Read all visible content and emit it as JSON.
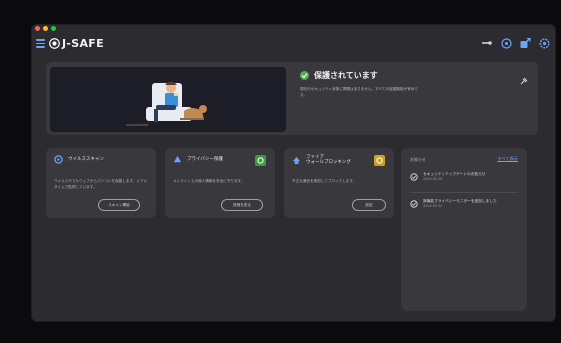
{
  "window": {
    "traffic_colors": [
      "#ff5f57",
      "#febc2e",
      "#28c840"
    ]
  },
  "titlebar": {
    "app_name": "J-SAFE",
    "icons": [
      "hamburger-icon",
      "globe-logo-icon",
      "key-icon",
      "help-icon",
      "share-icon",
      "settings-icon"
    ]
  },
  "hero": {
    "status_title": "保護されています",
    "status_desc": "現在のセキュリティ状態に問題はありません。すべての保護機能が有効です。",
    "accent": "#4caf50"
  },
  "cards": [
    {
      "id": "scan",
      "label": "ウイルススキャン",
      "icon": "shield-scan-icon",
      "desc": "ウイルスやマルウェアからパソコンを保護します。リアルタイムで監視しています。",
      "button": "スキャン開始",
      "badge": null
    },
    {
      "id": "privacy",
      "label": "プライバシー保護",
      "icon": "lock-icon",
      "desc": "オンライン上の個人情報を安全に守ります。",
      "button": "詳細を見る",
      "badge": "#3c9a3e"
    },
    {
      "id": "firewall",
      "label1": "ファイア",
      "label2": "ウォールブロッキング",
      "icon": "firewall-icon",
      "desc": "不正な通信を検知してブロックします。",
      "button": "設定",
      "badge": "#c9a227"
    }
  ],
  "news": {
    "header": "お知らせ",
    "link": "すべて表示",
    "items": [
      {
        "title": "セキュリティアップデートのお知らせ",
        "date": "2024.05.20"
      },
      {
        "title": "新機能プライバシーモニターを追加しました",
        "date": "2024.05.10"
      }
    ]
  }
}
